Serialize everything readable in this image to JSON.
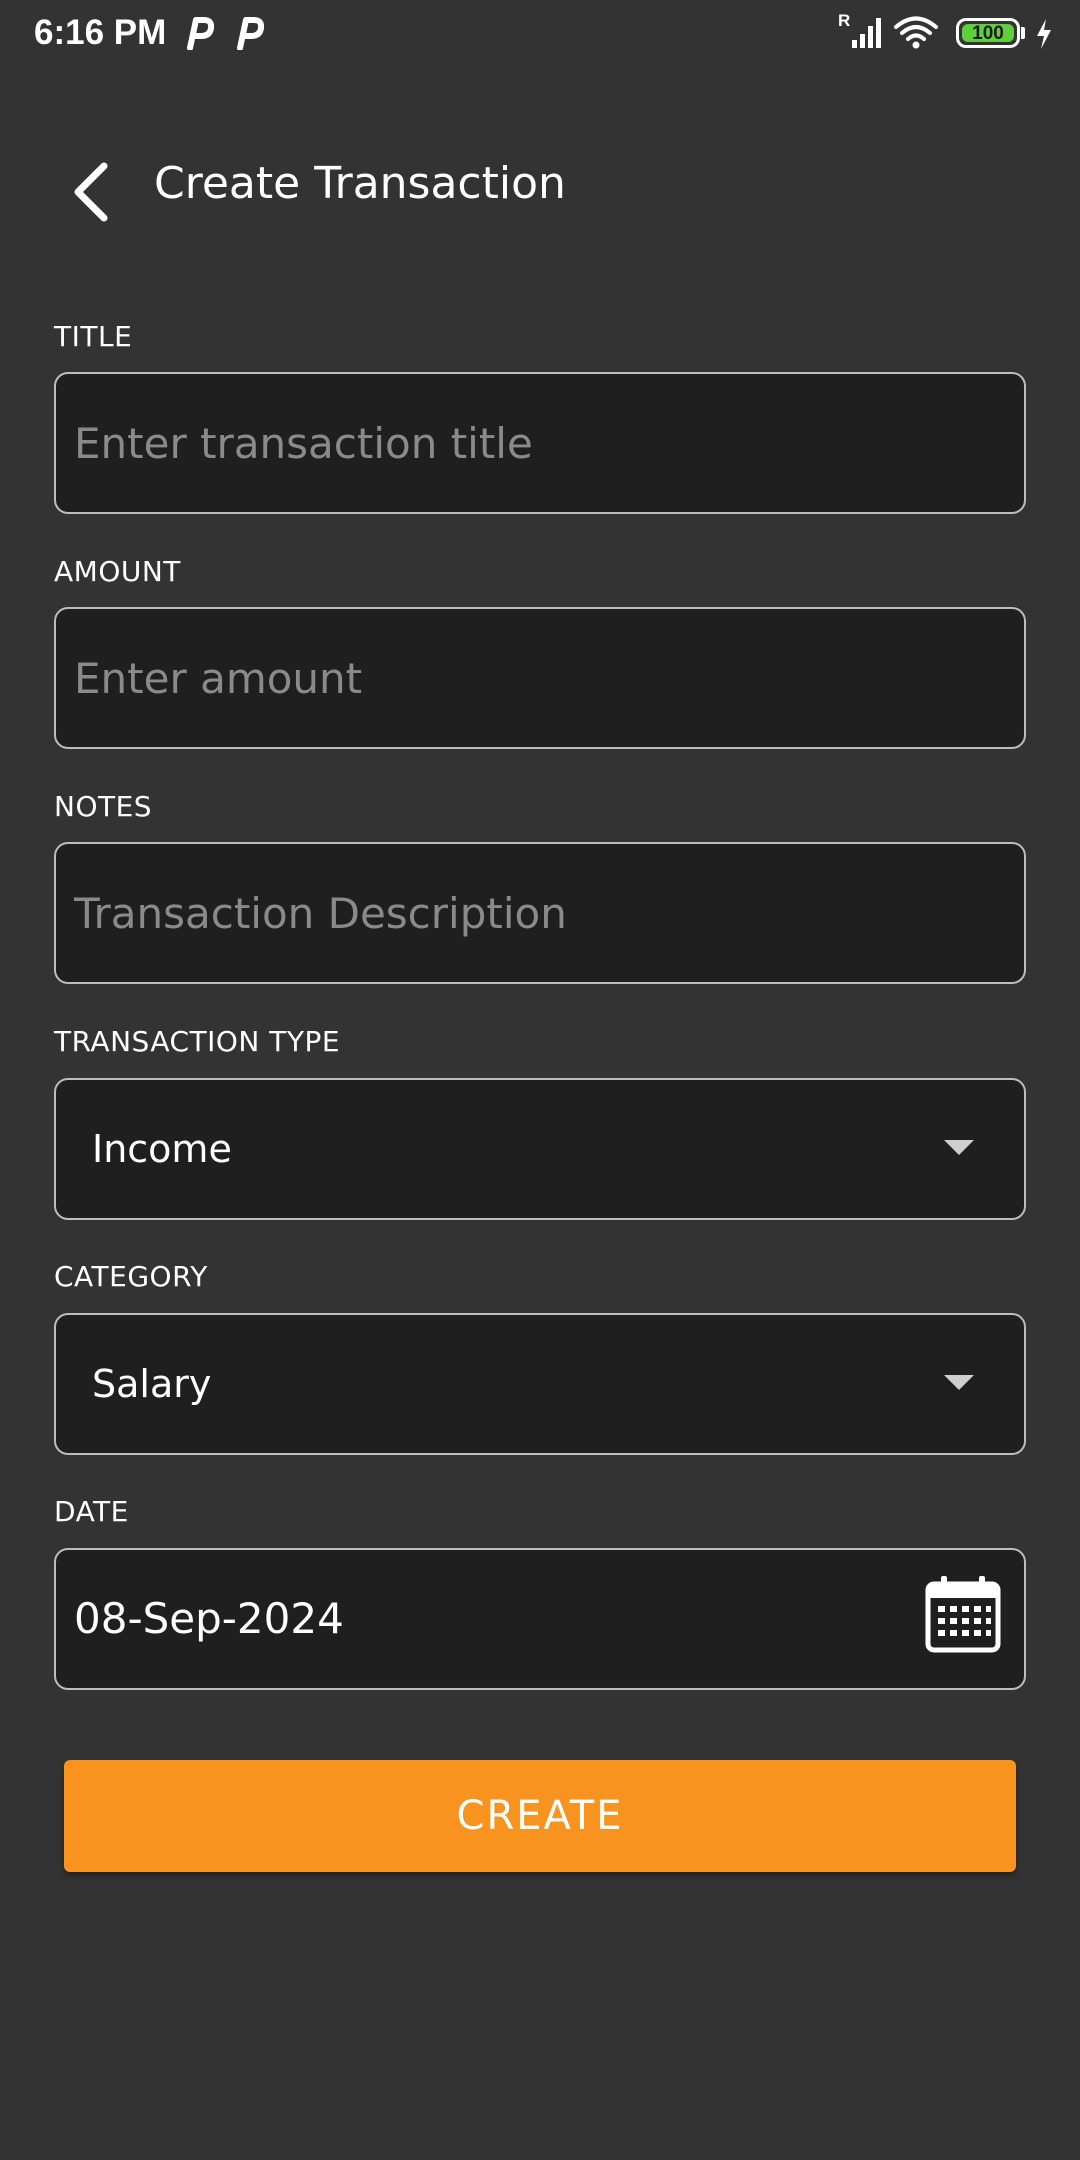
{
  "status_bar": {
    "time": "6:16 PM",
    "notification_icons": [
      "p-icon",
      "p-icon"
    ],
    "signal_label": "R",
    "battery": "100"
  },
  "header": {
    "title": "Create Transaction",
    "back_icon": "chevron-left-icon"
  },
  "form": {
    "title": {
      "label": "TITLE",
      "value": "",
      "placeholder": "Enter transaction title"
    },
    "amount": {
      "label": "AMOUNT",
      "value": "",
      "placeholder": "Enter amount"
    },
    "notes": {
      "label": "NOTES",
      "value": "",
      "placeholder": "Transaction Description"
    },
    "transaction_type": {
      "label": "TRANSACTION TYPE",
      "selected": "Income"
    },
    "category": {
      "label": "CATEGORY",
      "selected": "Salary"
    },
    "date": {
      "label": "DATE",
      "value": "08-Sep-2024",
      "icon": "calendar-icon"
    }
  },
  "actions": {
    "create_label": "CREATE"
  },
  "colors": {
    "background": "#333333",
    "field_background": "#1f1f1f",
    "field_border": "#bdbdbd",
    "accent": "#f7931e",
    "battery": "#5fcf3c"
  }
}
